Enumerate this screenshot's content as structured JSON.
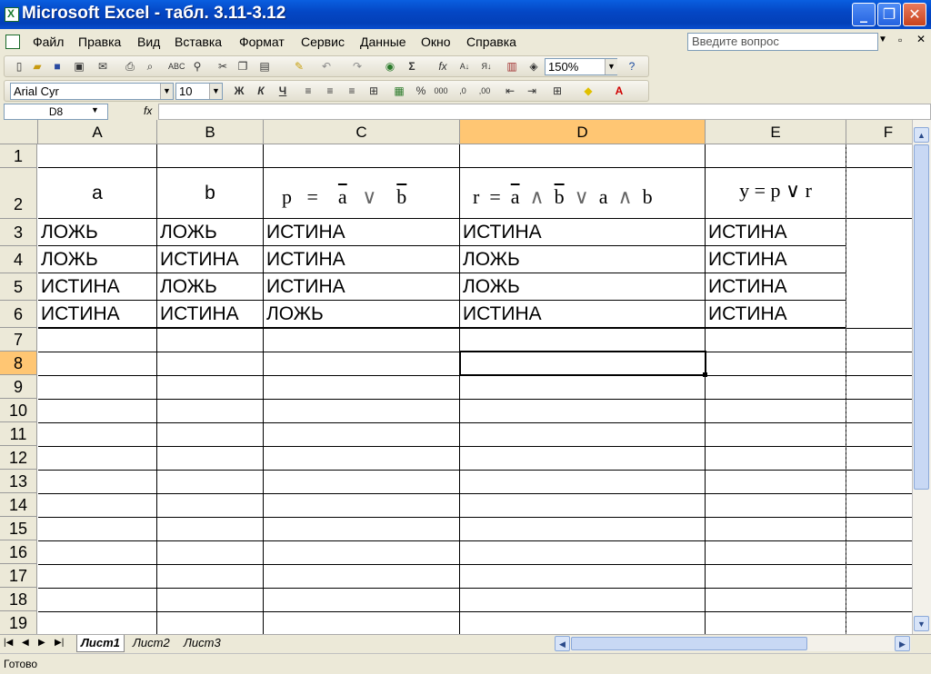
{
  "window": {
    "title": "Microsoft Excel - табл. 3.11-3.12"
  },
  "menu": [
    "Файл",
    "Правка",
    "Вид",
    "Вставка",
    "Формат",
    "Сервис",
    "Данные",
    "Окно",
    "Справка"
  ],
  "ask_question": "Введите вопрос",
  "toolbar": {
    "zoom": "150%",
    "font": "Arial Cyr",
    "font_size": "10"
  },
  "formula_bar": {
    "name_box": "D8",
    "fx": "fx",
    "content": ""
  },
  "columns": [
    "A",
    "B",
    "C",
    "D",
    "E",
    "F"
  ],
  "active_column": "D",
  "rows": [
    "1",
    "2",
    "3",
    "4",
    "5",
    "6",
    "7",
    "8",
    "9",
    "10",
    "11",
    "12",
    "13",
    "14",
    "15",
    "16",
    "17",
    "18",
    "19"
  ],
  "active_row": "8",
  "table": {
    "header": {
      "a": "a",
      "b": "b",
      "p_formula": {
        "lhs": "p",
        "eq": "=",
        "v1": "a",
        "op": "∨",
        "v2": "b"
      },
      "r_formula": {
        "lhs": "r",
        "eq": "=",
        "v1": "a",
        "op1": "∧",
        "v2": "b",
        "op2": "∨",
        "v3": "a",
        "op3": "∧",
        "v4": "b"
      },
      "y_formula": "y = p ∨ r"
    },
    "data": [
      [
        "ЛОЖЬ",
        "ЛОЖЬ",
        "ИСТИНА",
        "ИСТИНА",
        "ИСТИНА"
      ],
      [
        "ЛОЖЬ",
        "ИСТИНА",
        "ИСТИНА",
        "ЛОЖЬ",
        "ИСТИНА"
      ],
      [
        "ИСТИНА",
        "ЛОЖЬ",
        "ИСТИНА",
        "ЛОЖЬ",
        "ИСТИНА"
      ],
      [
        "ИСТИНА",
        "ИСТИНА",
        "ЛОЖЬ",
        "ИСТИНА",
        "ИСТИНА"
      ]
    ]
  },
  "sheets": [
    "Лист1",
    "Лист2",
    "Лист3"
  ],
  "active_sheet": "Лист1",
  "status": "Готово"
}
